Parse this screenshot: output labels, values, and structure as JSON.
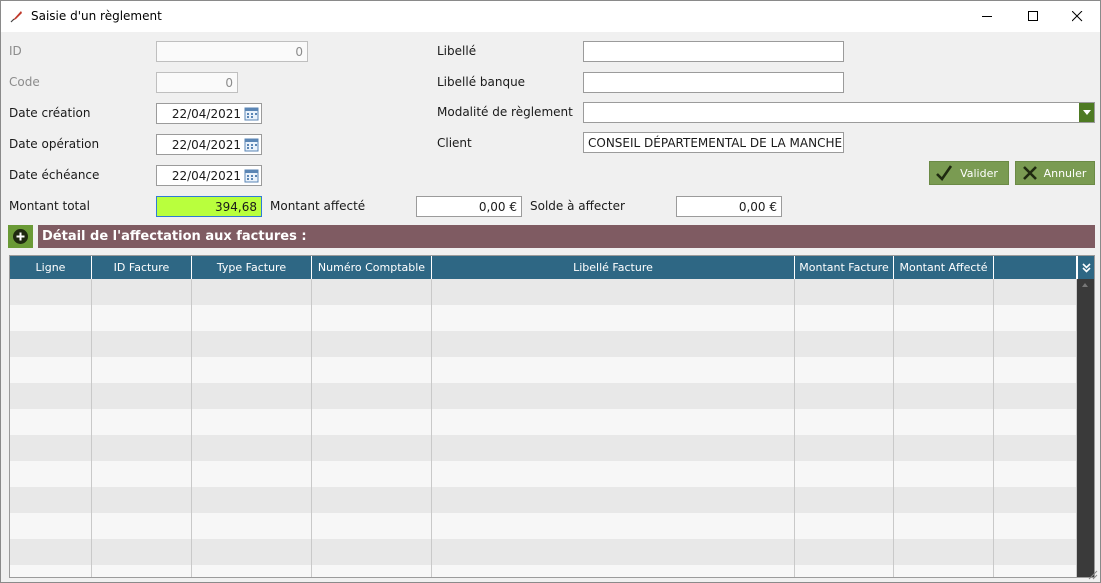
{
  "window": {
    "title": "Saisie d'un règlement"
  },
  "form": {
    "id": {
      "label": "ID",
      "value": "0"
    },
    "code": {
      "label": "Code",
      "value": "0"
    },
    "date_creation": {
      "label": "Date création",
      "value": "22/04/2021"
    },
    "date_operation": {
      "label": "Date opération",
      "value": "22/04/2021"
    },
    "date_echeance": {
      "label": "Date échéance",
      "value": "22/04/2021"
    },
    "montant_total": {
      "label": "Montant total",
      "value": "394,68"
    },
    "montant_affecte": {
      "label": "Montant affecté",
      "value": "0,00 €"
    },
    "solde_a_affecter": {
      "label": "Solde à affecter",
      "value": "0,00 €"
    },
    "libelle": {
      "label": "Libellé",
      "value": ""
    },
    "libelle_banque": {
      "label": "Libellé banque",
      "value": ""
    },
    "modalite": {
      "label": "Modalité de règlement",
      "value": ""
    },
    "client": {
      "label": "Client",
      "value": "CONSEIL DÉPARTEMENTAL DE LA MANCHE"
    }
  },
  "actions": {
    "valider": "Valider",
    "annuler": "Annuler"
  },
  "section": {
    "title": "Détail de l'affectation aux factures :"
  },
  "table": {
    "columns": [
      "Ligne",
      "ID Facture",
      "Type Facture",
      "Numéro Comptable",
      "Libellé Facture",
      "Montant Facture",
      "Montant Affecté",
      ""
    ],
    "rows": []
  },
  "colors": {
    "header_bg": "#2e6784",
    "section_bg": "#7f5b62",
    "button_bg": "#7a9b52",
    "highlight": "#b9ff3d"
  }
}
